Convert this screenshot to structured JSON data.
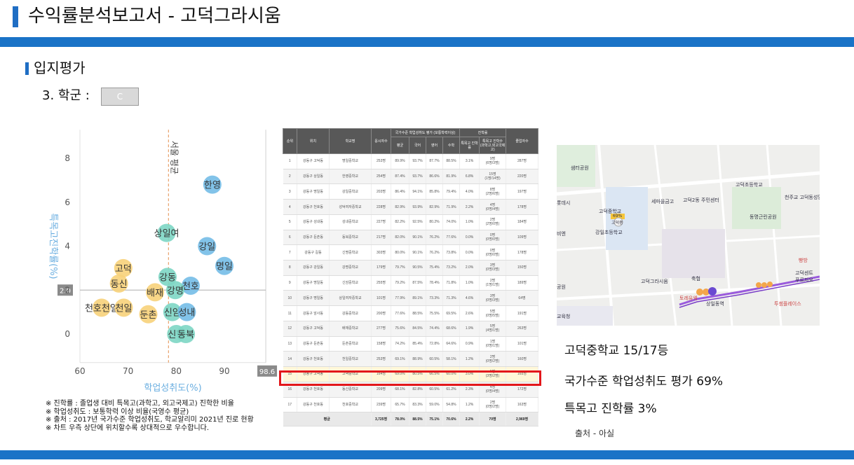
{
  "header": {
    "title": "수익률분석보고서 - 고덕그라시움"
  },
  "section": {
    "title": "입지평가"
  },
  "school": {
    "label": "3. 학군 :",
    "grade": "C"
  },
  "chart_data": {
    "type": "scatter",
    "xlabel": "학업성취도(%)",
    "ylabel": "특목고진학률(%)",
    "xlim": [
      60,
      100
    ],
    "ylim": [
      -1,
      9
    ],
    "xticks": [
      60,
      70,
      80,
      90
    ],
    "yticks": [
      0,
      2,
      4,
      6,
      8
    ],
    "ref_x": {
      "value": 78.4,
      "label": "서울 평균"
    },
    "ref_y": {
      "value": 2.0,
      "label": "2.0"
    },
    "x_max_marker": "98.6",
    "points": [
      {
        "name": "한영",
        "x": 87.5,
        "y": 6.8,
        "group": "blue"
      },
      {
        "name": "상일여",
        "x": 78.0,
        "y": 4.6,
        "group": "teal"
      },
      {
        "name": "강일",
        "x": 86.4,
        "y": 4.0,
        "group": "blue"
      },
      {
        "name": "명일",
        "x": 90.0,
        "y": 3.1,
        "group": "blue"
      },
      {
        "name": "고덕",
        "x": 69.0,
        "y": 3.0,
        "group": "yellow"
      },
      {
        "name": "동신",
        "x": 68.1,
        "y": 2.3,
        "group": "yellow"
      },
      {
        "name": "강동",
        "x": 78.2,
        "y": 2.6,
        "group": "teal"
      },
      {
        "name": "천호",
        "x": 83.0,
        "y": 2.2,
        "group": "blue"
      },
      {
        "name": "배재",
        "x": 75.6,
        "y": 1.9,
        "group": "yellow"
      },
      {
        "name": "강명",
        "x": 79.8,
        "y": 2.0,
        "group": "teal"
      },
      {
        "name": "천호천일",
        "x": 64.5,
        "y": 1.2,
        "group": "yellow"
      },
      {
        "name": "천일",
        "x": 69.1,
        "y": 1.2,
        "group": "yellow"
      },
      {
        "name": "둔촌",
        "x": 74.2,
        "y": 0.9,
        "group": "yellow"
      },
      {
        "name": "신암",
        "x": 79.2,
        "y": 1.0,
        "group": "teal"
      },
      {
        "name": "성내",
        "x": 82.2,
        "y": 1.0,
        "group": "blue"
      },
      {
        "name": "신명",
        "x": 80.0,
        "y": 0.0,
        "group": "teal"
      },
      {
        "name": "동북",
        "x": 82.0,
        "y": 0.0,
        "group": "teal"
      }
    ],
    "colors": {
      "blue": "#74bde7",
      "teal": "#7dd6c4",
      "yellow": "#f7d27a"
    }
  },
  "notes": [
    "※ 진학률 : 졸업생 대비 특목고(과학고, 외고국제고) 진학한 비율",
    "※ 학업성취도 : 보통학력 이상 비율(국영수 평균)",
    "※ 출처 : 2017년 국가수준 학업성취도, 학교알리미 2021년 진로 현황",
    "※ 차트 우측 상단에 위치할수록 상대적으로 우수합니다."
  ],
  "table": {
    "headers": {
      "rank": "순위",
      "region": "위치",
      "school": "학교명",
      "test": "응시자수",
      "group_score": "국가수준 학업성취도 평가 (보통학력이상)",
      "avg": "평균",
      "kor": "국어",
      "eng": "영어",
      "math": "수학",
      "group_adv": "진학률",
      "rate": "특목고 진학률",
      "adv_count": "특목고 진학수",
      "adv_sub": "(과학고,외고국제고)",
      "grads": "졸업자수"
    },
    "rows": [
      [
        "1",
        "강동구 고덕동",
        "명일중학교",
        "253명",
        "89.9%",
        "93.7%",
        "87.7%",
        "88.5%",
        "3.1%",
        "9명",
        "(6명/3명)",
        "287명"
      ],
      [
        "2",
        "강동구 상일동",
        "한영중학교",
        "254명",
        "87.4%",
        "93.7%",
        "86.6%",
        "81.9%",
        "6.8%",
        "15명",
        "(1명/14명)",
        "220명"
      ],
      [
        "3",
        "강동구 명일동",
        "강일중학교",
        "203명",
        "86.4%",
        "94.1%",
        "85.8%",
        "79.4%",
        "4.0%",
        "8명",
        "(2명/6명)",
        "197명"
      ],
      [
        "4",
        "강동구 천호동",
        "성덕여자중학교",
        "228명",
        "82.9%",
        "93.9%",
        "82.9%",
        "71.9%",
        "2.2%",
        "4명",
        "(0명/4명)",
        "178명"
      ],
      [
        "5",
        "강동구 성내동",
        "성내중학교",
        "227명",
        "82.2%",
        "92.5%",
        "80.2%",
        "74.0%",
        "1.0%",
        "2명",
        "(2명/0명)",
        "184명"
      ],
      [
        "6",
        "강동구 둔촌동",
        "동북중학교",
        "217명",
        "82.0%",
        "90.1%",
        "76.2%",
        "77.6%",
        "0.0%",
        "0명",
        "(0명/0명)",
        "109명"
      ],
      [
        "7",
        "강동구 길동",
        "신명중학교",
        "303명",
        "80.0%",
        "90.1%",
        "76.2%",
        "73.8%",
        "0.0%",
        "0명",
        "(0명/0명)",
        "178명"
      ],
      [
        "8",
        "강동구 강일동",
        "강명중학교",
        "179명",
        "79.7%",
        "90.5%",
        "75.4%",
        "73.2%",
        "2.0%",
        "3명",
        "(0명/3명)",
        "150명"
      ],
      [
        "9",
        "강동구 명일동",
        "신암중학교",
        "255명",
        "79.2%",
        "87.5%",
        "78.4%",
        "71.8%",
        "1.0%",
        "2명",
        "(1명/1명)",
        "189명"
      ],
      [
        "10",
        "강동구 명일동",
        "상일여자중학교",
        "101명",
        "77.9%",
        "89.1%",
        "73.3%",
        "71.3%",
        "4.6%",
        "3명",
        "(0명/3명)",
        "64명"
      ],
      [
        "11",
        "강동구 암사동",
        "강동중학교",
        "200명",
        "77.6%",
        "88.5%",
        "75.5%",
        "69.5%",
        "2.6%",
        "5명",
        "(0명/5명)",
        "191명"
      ],
      [
        "12",
        "강동구 고덕동",
        "배재중학교",
        "277명",
        "75.6%",
        "84.5%",
        "74.4%",
        "68.6%",
        "1.9%",
        "5명",
        "(4명/1명)",
        "263명"
      ],
      [
        "13",
        "강동구 둔촌동",
        "둔촌중학교",
        "158명",
        "74.2%",
        "85.4%",
        "72.8%",
        "64.6%",
        "0.9%",
        "1명",
        "(0명/1명)",
        "101명"
      ],
      [
        "14",
        "강동구 천호동",
        "천일중학교",
        "253명",
        "69.1%",
        "88.9%",
        "60.5%",
        "58.1%",
        "1.2%",
        "2명",
        "(0명/2명)",
        "160명"
      ],
      [
        "15",
        "강동구 고덕동",
        "고덕중학교",
        "164명",
        "69.0%",
        "80.5%",
        "66.5%",
        "60.0%",
        "3.0%",
        "5명",
        "(3명/2명)",
        "165명"
      ],
      [
        "16",
        "강동구 천호동",
        "동신중학교",
        "209명",
        "68.1%",
        "82.8%",
        "60.5%",
        "61.2%",
        "2.3%",
        "4명",
        "(0명/4명)",
        "172명"
      ],
      [
        "17",
        "강동구 천호동",
        "천호중학교",
        "239명",
        "65.7%",
        "83.3%",
        "59.0%",
        "54.8%",
        "1.2%",
        "2명",
        "(0명/2명)",
        "163명"
      ]
    ],
    "total": [
      "평균",
      "3,725명",
      "78.0%",
      "88.5%",
      "75.1%",
      "70.6%",
      "2.2%",
      "70명",
      "2,969명"
    ]
  },
  "map": {
    "labels": {
      "park1": "샘터공원",
      "elem1": "고덕초등학교",
      "mart": "세마을금고",
      "center": "고덕2동 주민센터",
      "church": "천주교 고덕동성당",
      "middle": "고덕중학교",
      "pct": "69%",
      "pin": "고덕중",
      "elem2": "강일초등학교",
      "park2": "동명근린공원",
      "apt": "고덕그라시움",
      "bus": "축협",
      "station": "상일동역",
      "fmart": "토레유웨",
      "shop": "투썸플레이스",
      "bakery": "빵방",
      "edge1": "공원",
      "edge2": "교육청",
      "edge3": "롯데시",
      "edge4": "비엔",
      "edge5": "고덕센트",
      "edge6": "푸르지오"
    }
  },
  "facts": {
    "school_line": "고덕중학교 15/17등",
    "score_line": "국가수준 학업성취도 평가 69%",
    "rate_line": "특목고 진학률 3%",
    "source": "출처 - 아실"
  }
}
